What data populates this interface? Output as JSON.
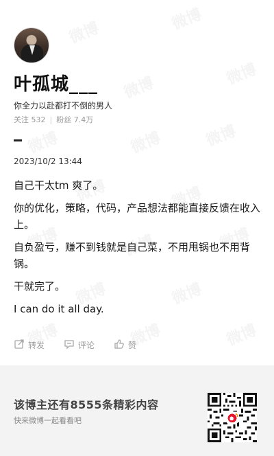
{
  "profile": {
    "username": "叶孤城___",
    "bio": "你全力以赴都打不倒的男人",
    "following_label": "关注",
    "following_count": "532",
    "followers_label": "粉丝",
    "followers_count": "7.4万"
  },
  "post": {
    "timestamp": "2023/10/2 13:44",
    "paragraphs": [
      "自己干太tm 爽了。",
      "你的优化，策略，代码，产品想法都能直接反馈在收入上。",
      "自负盈亏，赚不到钱就是自己菜，不用甩锅也不用背锅。",
      "干就完了。",
      "I can do it all day."
    ]
  },
  "actions": {
    "repost_label": "转发",
    "comment_label": "评论",
    "like_label": "赞"
  },
  "footer": {
    "title": "该博主还有8555条精彩内容",
    "subtitle": "快来微博一起看看吧"
  },
  "watermark": "微博",
  "colors": {
    "footer_bg": "#f3f3f3",
    "muted_text": "#999999",
    "accent": "#e6162d"
  }
}
